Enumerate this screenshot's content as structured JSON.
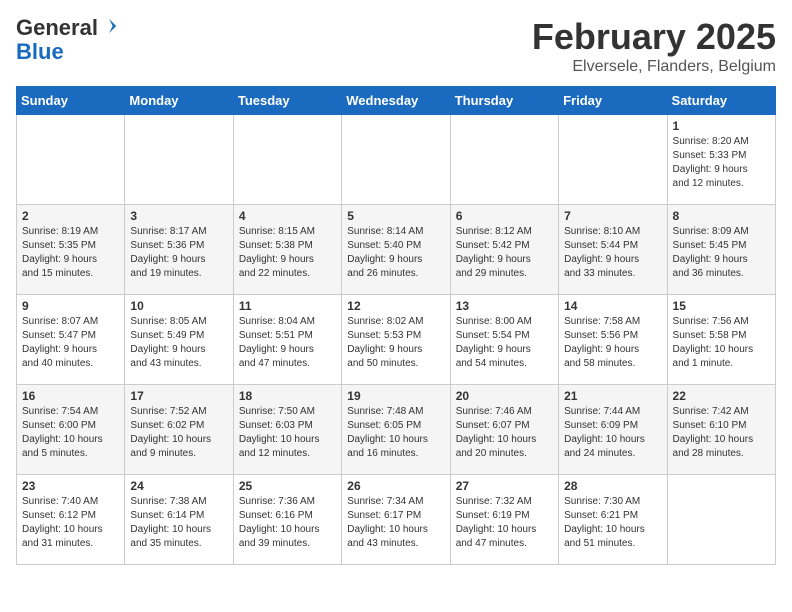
{
  "header": {
    "logo_general": "General",
    "logo_blue": "Blue",
    "title": "February 2025",
    "subtitle": "Elversele, Flanders, Belgium"
  },
  "weekdays": [
    "Sunday",
    "Monday",
    "Tuesday",
    "Wednesday",
    "Thursday",
    "Friday",
    "Saturday"
  ],
  "weeks": [
    [
      {
        "day": "",
        "info": ""
      },
      {
        "day": "",
        "info": ""
      },
      {
        "day": "",
        "info": ""
      },
      {
        "day": "",
        "info": ""
      },
      {
        "day": "",
        "info": ""
      },
      {
        "day": "",
        "info": ""
      },
      {
        "day": "1",
        "info": "Sunrise: 8:20 AM\nSunset: 5:33 PM\nDaylight: 9 hours\nand 12 minutes."
      }
    ],
    [
      {
        "day": "2",
        "info": "Sunrise: 8:19 AM\nSunset: 5:35 PM\nDaylight: 9 hours\nand 15 minutes."
      },
      {
        "day": "3",
        "info": "Sunrise: 8:17 AM\nSunset: 5:36 PM\nDaylight: 9 hours\nand 19 minutes."
      },
      {
        "day": "4",
        "info": "Sunrise: 8:15 AM\nSunset: 5:38 PM\nDaylight: 9 hours\nand 22 minutes."
      },
      {
        "day": "5",
        "info": "Sunrise: 8:14 AM\nSunset: 5:40 PM\nDaylight: 9 hours\nand 26 minutes."
      },
      {
        "day": "6",
        "info": "Sunrise: 8:12 AM\nSunset: 5:42 PM\nDaylight: 9 hours\nand 29 minutes."
      },
      {
        "day": "7",
        "info": "Sunrise: 8:10 AM\nSunset: 5:44 PM\nDaylight: 9 hours\nand 33 minutes."
      },
      {
        "day": "8",
        "info": "Sunrise: 8:09 AM\nSunset: 5:45 PM\nDaylight: 9 hours\nand 36 minutes."
      }
    ],
    [
      {
        "day": "9",
        "info": "Sunrise: 8:07 AM\nSunset: 5:47 PM\nDaylight: 9 hours\nand 40 minutes."
      },
      {
        "day": "10",
        "info": "Sunrise: 8:05 AM\nSunset: 5:49 PM\nDaylight: 9 hours\nand 43 minutes."
      },
      {
        "day": "11",
        "info": "Sunrise: 8:04 AM\nSunset: 5:51 PM\nDaylight: 9 hours\nand 47 minutes."
      },
      {
        "day": "12",
        "info": "Sunrise: 8:02 AM\nSunset: 5:53 PM\nDaylight: 9 hours\nand 50 minutes."
      },
      {
        "day": "13",
        "info": "Sunrise: 8:00 AM\nSunset: 5:54 PM\nDaylight: 9 hours\nand 54 minutes."
      },
      {
        "day": "14",
        "info": "Sunrise: 7:58 AM\nSunset: 5:56 PM\nDaylight: 9 hours\nand 58 minutes."
      },
      {
        "day": "15",
        "info": "Sunrise: 7:56 AM\nSunset: 5:58 PM\nDaylight: 10 hours\nand 1 minute."
      }
    ],
    [
      {
        "day": "16",
        "info": "Sunrise: 7:54 AM\nSunset: 6:00 PM\nDaylight: 10 hours\nand 5 minutes."
      },
      {
        "day": "17",
        "info": "Sunrise: 7:52 AM\nSunset: 6:02 PM\nDaylight: 10 hours\nand 9 minutes."
      },
      {
        "day": "18",
        "info": "Sunrise: 7:50 AM\nSunset: 6:03 PM\nDaylight: 10 hours\nand 12 minutes."
      },
      {
        "day": "19",
        "info": "Sunrise: 7:48 AM\nSunset: 6:05 PM\nDaylight: 10 hours\nand 16 minutes."
      },
      {
        "day": "20",
        "info": "Sunrise: 7:46 AM\nSunset: 6:07 PM\nDaylight: 10 hours\nand 20 minutes."
      },
      {
        "day": "21",
        "info": "Sunrise: 7:44 AM\nSunset: 6:09 PM\nDaylight: 10 hours\nand 24 minutes."
      },
      {
        "day": "22",
        "info": "Sunrise: 7:42 AM\nSunset: 6:10 PM\nDaylight: 10 hours\nand 28 minutes."
      }
    ],
    [
      {
        "day": "23",
        "info": "Sunrise: 7:40 AM\nSunset: 6:12 PM\nDaylight: 10 hours\nand 31 minutes."
      },
      {
        "day": "24",
        "info": "Sunrise: 7:38 AM\nSunset: 6:14 PM\nDaylight: 10 hours\nand 35 minutes."
      },
      {
        "day": "25",
        "info": "Sunrise: 7:36 AM\nSunset: 6:16 PM\nDaylight: 10 hours\nand 39 minutes."
      },
      {
        "day": "26",
        "info": "Sunrise: 7:34 AM\nSunset: 6:17 PM\nDaylight: 10 hours\nand 43 minutes."
      },
      {
        "day": "27",
        "info": "Sunrise: 7:32 AM\nSunset: 6:19 PM\nDaylight: 10 hours\nand 47 minutes."
      },
      {
        "day": "28",
        "info": "Sunrise: 7:30 AM\nSunset: 6:21 PM\nDaylight: 10 hours\nand 51 minutes."
      },
      {
        "day": "",
        "info": ""
      }
    ]
  ]
}
